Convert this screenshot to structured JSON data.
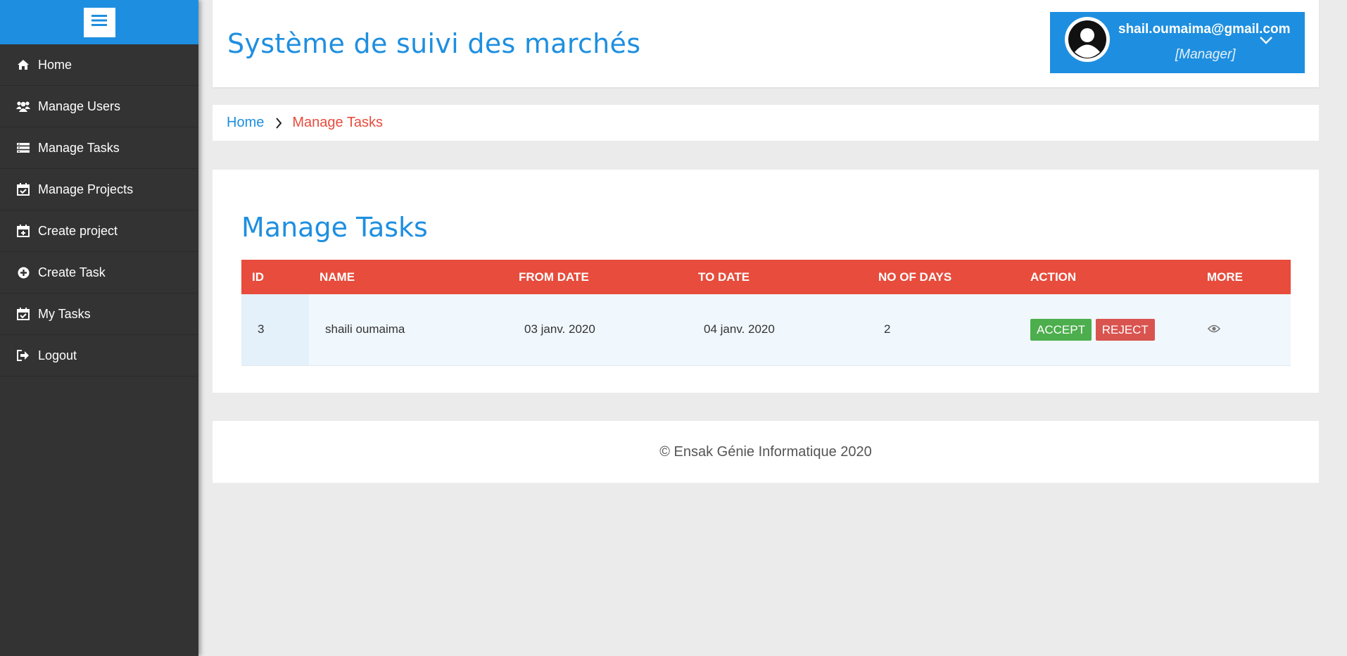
{
  "sidebar": {
    "toggle_icon": "hamburger-icon",
    "items": [
      {
        "label": "Home",
        "icon": "home-icon"
      },
      {
        "label": "Manage Users",
        "icon": "users-icon"
      },
      {
        "label": "Manage Tasks",
        "icon": "tasks-list-icon"
      },
      {
        "label": "Manage Projects",
        "icon": "calendar-check-icon"
      },
      {
        "label": "Create project",
        "icon": "calendar-plus-icon"
      },
      {
        "label": "Create Task",
        "icon": "plus-circle-icon"
      },
      {
        "label": "My Tasks",
        "icon": "calendar-check-icon"
      },
      {
        "label": "Logout",
        "icon": "sign-out-icon"
      }
    ]
  },
  "header": {
    "title": "Système de suivi des marchés",
    "user": {
      "email": "shail.oumaima@gmail.com",
      "role": "[Manager]"
    }
  },
  "breadcrumb": {
    "home": "Home",
    "current": "Manage Tasks"
  },
  "main": {
    "title": "Manage Tasks",
    "table": {
      "columns": [
        "ID",
        "NAME",
        "FROM DATE",
        "TO DATE",
        "NO OF DAYS",
        "ACTION",
        "MORE"
      ],
      "rows": [
        {
          "id": "3",
          "name": "shaili oumaima",
          "from_date": "03 janv. 2020",
          "to_date": "04 janv. 2020",
          "days": "2",
          "accept_label": "ACCEPT",
          "reject_label": "REJECT"
        }
      ]
    }
  },
  "footer": {
    "text": "© Ensak Génie Informatique 2020"
  },
  "colors": {
    "accent": "#1e8fe0",
    "danger": "#e74c3c",
    "success": "#4cae4c",
    "sidebar": "#333333"
  }
}
